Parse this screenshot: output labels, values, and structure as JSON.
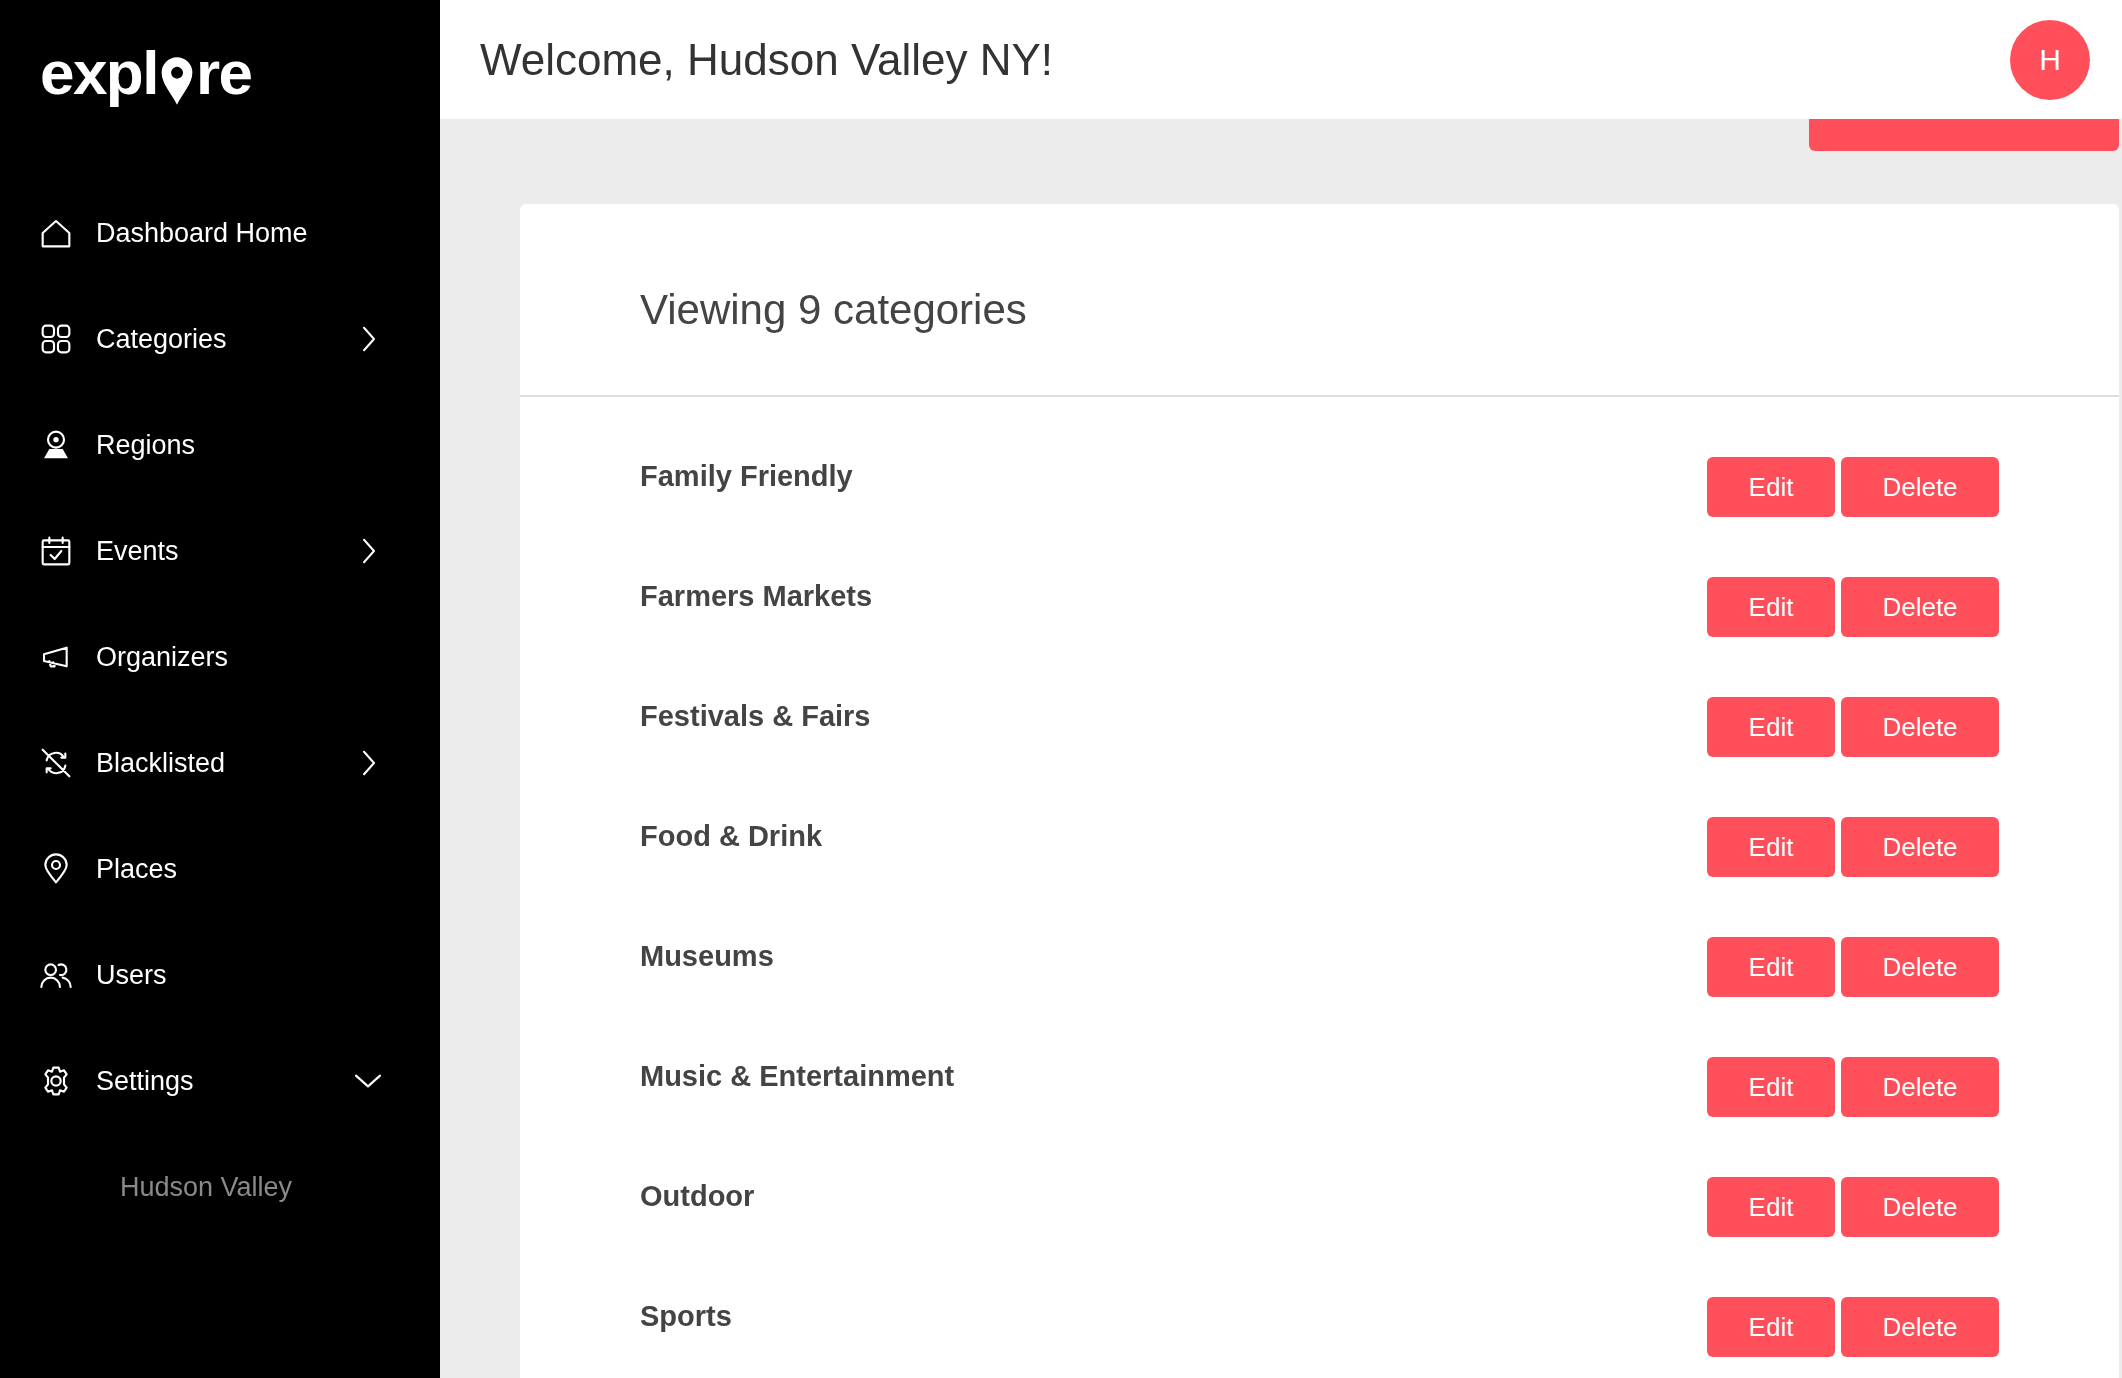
{
  "sidebar": {
    "logo": {
      "before": "expl",
      "after": "re"
    },
    "items": [
      {
        "label": "Dashboard Home"
      },
      {
        "label": "Categories",
        "expanded": false
      },
      {
        "label": "Regions"
      },
      {
        "label": "Events",
        "expanded": false
      },
      {
        "label": "Organizers"
      },
      {
        "label": "Blacklisted",
        "expanded": false
      },
      {
        "label": "Places"
      },
      {
        "label": "Users"
      },
      {
        "label": "Settings",
        "expanded": true,
        "children": [
          {
            "label": "Hudson Valley"
          }
        ]
      }
    ]
  },
  "header": {
    "welcome": "Welcome, Hudson Valley NY!",
    "avatar": "H"
  },
  "card": {
    "heading": "Viewing 9 categories",
    "rows": [
      {
        "name": "Family Friendly",
        "actions": [
          "Edit",
          "Delete"
        ]
      },
      {
        "name": "Farmers Markets",
        "actions": [
          "Edit",
          "Delete"
        ]
      },
      {
        "name": "Festivals & Fairs",
        "actions": [
          "Edit",
          "Delete"
        ]
      },
      {
        "name": "Food & Drink",
        "actions": [
          "Edit",
          "Delete"
        ]
      },
      {
        "name": "Museums",
        "actions": [
          "Edit",
          "Delete"
        ]
      },
      {
        "name": "Music & Entertainment",
        "actions": [
          "Edit",
          "Delete"
        ]
      },
      {
        "name": "Outdoor",
        "actions": [
          "Edit",
          "Delete"
        ]
      },
      {
        "name": "Sports",
        "actions": [
          "Edit",
          "Delete"
        ]
      }
    ]
  }
}
